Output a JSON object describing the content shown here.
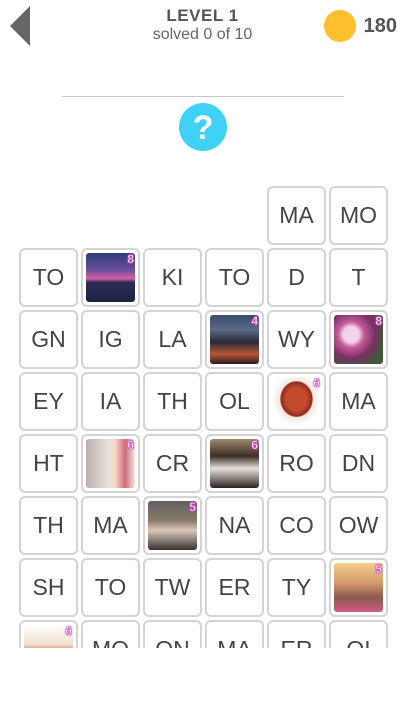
{
  "header": {
    "level_title": "LEVEL 1",
    "progress_text": "solved 0 of 10",
    "coins": "180",
    "coin_color": "#ffc02e"
  },
  "hint": {
    "symbol": "?",
    "color": "#3fd2f6"
  },
  "board": {
    "rows": [
      [
        null,
        null,
        null,
        null,
        {
          "text": "MA"
        },
        {
          "text": "MO"
        }
      ],
      [
        {
          "text": "TO"
        },
        {
          "image": "sunset-photo",
          "count": "8"
        },
        {
          "text": "KI"
        },
        {
          "text": "TO"
        },
        {
          "text": "D"
        },
        {
          "text": "T"
        }
      ],
      [
        {
          "text": "GN"
        },
        {
          "text": "IG"
        },
        {
          "text": "LA"
        },
        {
          "image": "city-street-photo",
          "count": "4"
        },
        {
          "text": "WY"
        },
        {
          "image": "magnolia-photo",
          "count": "8"
        }
      ],
      [
        {
          "text": "EY"
        },
        {
          "text": "IA"
        },
        {
          "text": "TH"
        },
        {
          "text": "OL"
        },
        {
          "image": "kidney-photo",
          "count": "6"
        },
        {
          "text": "MA"
        }
      ],
      [
        {
          "text": "HT"
        },
        {
          "image": "mother-daughter-photo",
          "count": "6"
        },
        {
          "text": "CR"
        },
        {
          "image": "dancer-photo",
          "count": "6"
        },
        {
          "text": "RO"
        },
        {
          "text": "DN"
        }
      ],
      [
        {
          "text": "TH"
        },
        {
          "text": "MA"
        },
        {
          "image": "crowd-photo",
          "count": "5"
        },
        {
          "text": "NA"
        },
        {
          "text": "CO"
        },
        {
          "text": "OW"
        }
      ],
      [
        {
          "text": "SH"
        },
        {
          "text": "TO"
        },
        {
          "text": "TW"
        },
        {
          "text": "ER"
        },
        {
          "text": "TY"
        },
        {
          "image": "girl-photo",
          "count": "5"
        }
      ],
      [
        {
          "image": "fruit-photo",
          "count": "6"
        },
        {
          "text": "MO"
        },
        {
          "text": "ON"
        },
        {
          "text": "MA"
        },
        {
          "text": "ER"
        },
        {
          "text": "OI"
        }
      ]
    ]
  }
}
